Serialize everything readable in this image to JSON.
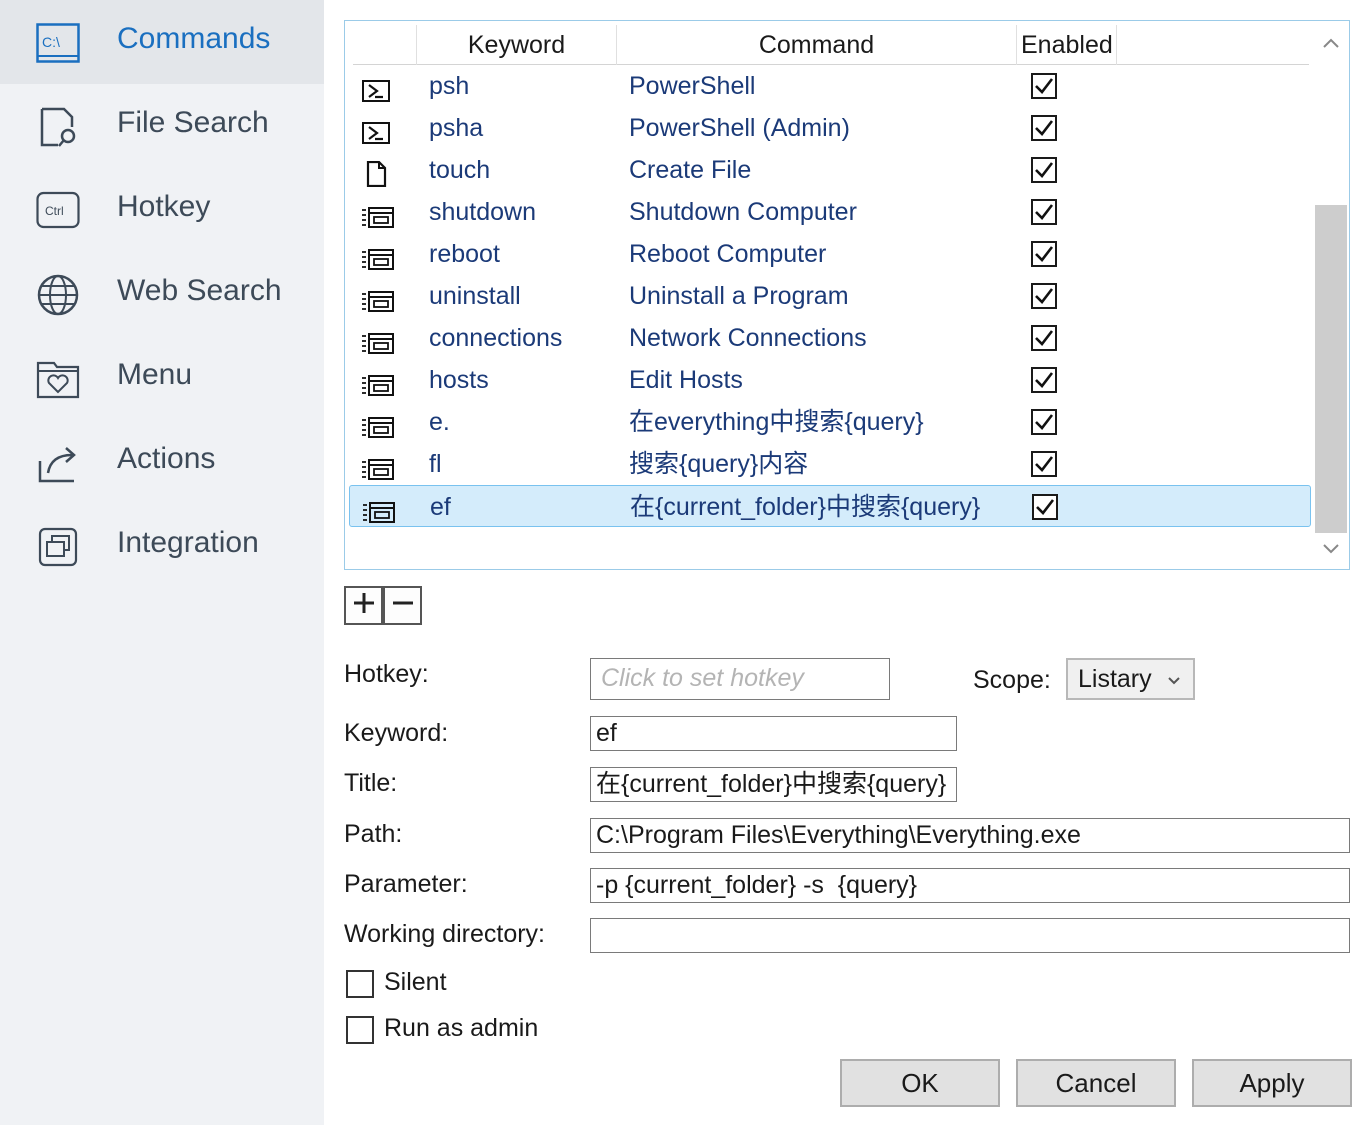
{
  "sidebar": {
    "items": [
      {
        "label": "Commands",
        "icon": "command-prompt-icon",
        "active": true
      },
      {
        "label": "File Search",
        "icon": "file-search-icon"
      },
      {
        "label": "Hotkey",
        "icon": "ctrl-key-icon"
      },
      {
        "label": "Web Search",
        "icon": "globe-icon"
      },
      {
        "label": "Menu",
        "icon": "heart-folder-icon"
      },
      {
        "label": "Actions",
        "icon": "share-arrow-icon"
      },
      {
        "label": "Integration",
        "icon": "window-stack-icon"
      }
    ],
    "ctrl_text": "Ctrl",
    "cmd_text": "C:\\"
  },
  "table": {
    "columns": {
      "keyword": "Keyword",
      "command": "Command",
      "enabled": "Enabled"
    },
    "rows": [
      {
        "icon": "powershell-icon",
        "keyword": "psh",
        "command": "PowerShell",
        "enabled": true
      },
      {
        "icon": "powershell-icon",
        "keyword": "psha",
        "command": "PowerShell (Admin)",
        "enabled": true
      },
      {
        "icon": "file-icon",
        "keyword": "touch",
        "command": "Create File",
        "enabled": true
      },
      {
        "icon": "command-icon",
        "keyword": "shutdown",
        "command": "Shutdown Computer",
        "enabled": true
      },
      {
        "icon": "command-icon",
        "keyword": "reboot",
        "command": "Reboot Computer",
        "enabled": true
      },
      {
        "icon": "command-icon",
        "keyword": "uninstall",
        "command": "Uninstall a Program",
        "enabled": true
      },
      {
        "icon": "command-icon",
        "keyword": "connections",
        "command": "Network Connections",
        "enabled": true
      },
      {
        "icon": "command-icon",
        "keyword": "hosts",
        "command": "Edit Hosts",
        "enabled": true
      },
      {
        "icon": "command-icon",
        "keyword": "e.",
        "command": "在everything中搜索{query}",
        "enabled": true
      },
      {
        "icon": "command-icon",
        "keyword": "fl",
        "command": "搜索{query}内容",
        "enabled": true
      },
      {
        "icon": "command-icon",
        "keyword": "ef",
        "command": "在{current_folder}中搜索{query}",
        "enabled": true,
        "selected": true
      }
    ]
  },
  "form": {
    "hotkey_label": "Hotkey:",
    "hotkey_placeholder": "Click to set hotkey",
    "scope_label": "Scope:",
    "scope_value": "Listary",
    "keyword_label": "Keyword:",
    "keyword_value": "ef",
    "title_label": "Title:",
    "title_value": "在{current_folder}中搜索{query}",
    "path_label": "Path:",
    "path_value": "C:\\Program Files\\Everything\\Everything.exe",
    "parameter_label": "Parameter:",
    "parameter_value": "-p {current_folder} -s  {query}",
    "workdir_label": "Working directory:",
    "workdir_value": "",
    "silent_label": "Silent",
    "silent_checked": false,
    "admin_label": "Run as admin",
    "admin_checked": false
  },
  "buttons": {
    "ok": "OK",
    "cancel": "Cancel",
    "apply": "Apply"
  },
  "colors": {
    "accent": "#1a6fc0",
    "selection": "#d4ecfb",
    "link_text": "#1b3a78"
  }
}
